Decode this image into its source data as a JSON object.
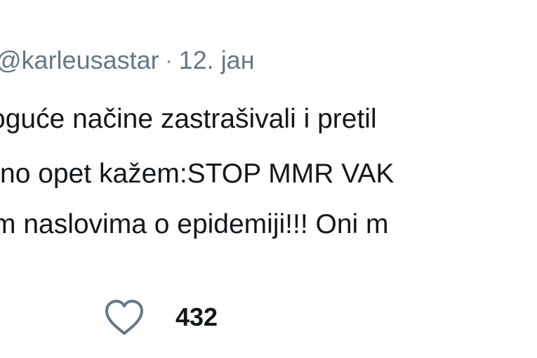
{
  "tweet": {
    "handle": "@karleusastar",
    "separator": "·",
    "date": "12. јан",
    "lines": [
      "ogućе načine zastrašivali i pretil",
      "no opet kažem:STOP MMR VAK",
      "m naslovima o epidemiji!!! Oni m"
    ],
    "like_icon": "heart-outline-icon",
    "like_count": "432"
  }
}
